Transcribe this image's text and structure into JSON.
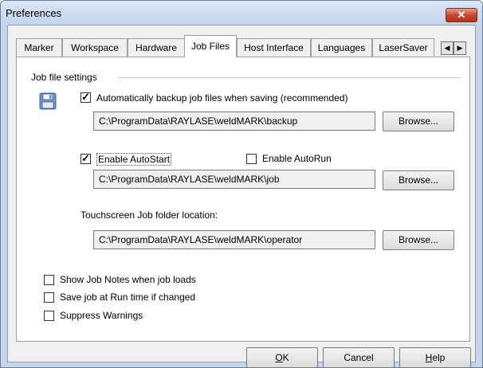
{
  "window": {
    "title": "Preferences",
    "close_glyph": "✕"
  },
  "tabs": [
    {
      "label": "Marker"
    },
    {
      "label": "Workspace"
    },
    {
      "label": "Hardware"
    },
    {
      "label": "Job Files"
    },
    {
      "label": "Host Interface"
    },
    {
      "label": "Languages"
    },
    {
      "label": "LaserSaver"
    }
  ],
  "tab_scroll": {
    "left_glyph": "◀",
    "right_glyph": "▶"
  },
  "group": {
    "label": "Job file settings"
  },
  "backup": {
    "checked": true,
    "label": "Automatically backup job files when saving  (recommended)",
    "path": "C:\\ProgramData\\RAYLASE\\weldMARK\\backup",
    "browse": "Browse..."
  },
  "autostart": {
    "checked": true,
    "label": "Enable AutoStart",
    "autorun_checked": false,
    "autorun_label": "Enable AutoRun",
    "path": "C:\\ProgramData\\RAYLASE\\weldMARK\\job",
    "browse": "Browse..."
  },
  "touchscreen": {
    "label": "Touchscreen Job folder location:",
    "path": "C:\\ProgramData\\RAYLASE\\weldMARK\\operator",
    "browse": "Browse..."
  },
  "options": [
    {
      "label": "Show Job Notes when job loads",
      "checked": false
    },
    {
      "label": "Save job at Run time if changed",
      "checked": false
    },
    {
      "label": "Suppress Warnings",
      "checked": false
    }
  ],
  "buttons": {
    "ok_mnemonic": "O",
    "ok_rest": "K",
    "cancel": "Cancel",
    "help_mnemonic": "H",
    "help_rest": "elp"
  },
  "check_glyph": "✓",
  "icons": {
    "disk": "floppy-disk-icon"
  },
  "colors": {
    "title_bar": "#c6d5ea",
    "close_button": "#c9452c",
    "panel": "#ffffff",
    "dialog_bg": "#f0f0f0"
  }
}
